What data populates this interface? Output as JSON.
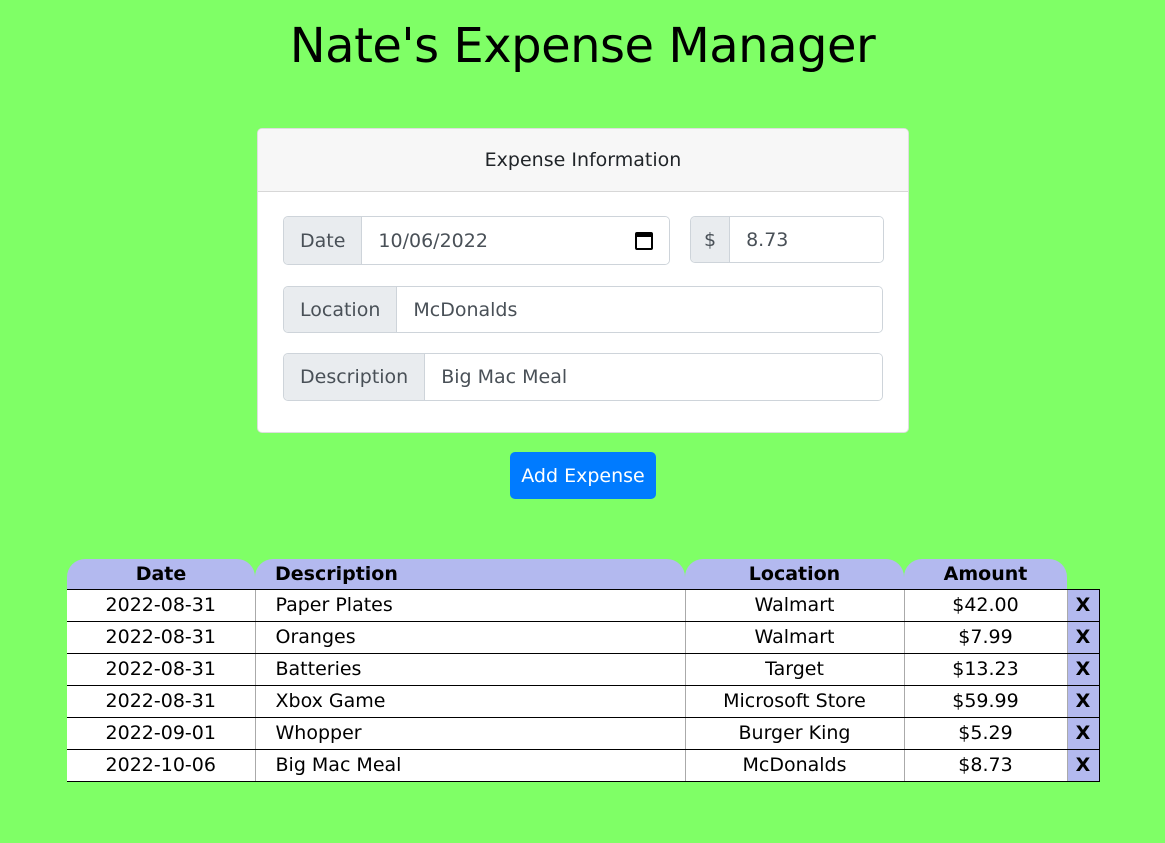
{
  "header": {
    "title": "Nate's Expense Manager"
  },
  "form": {
    "card_title": "Expense Information",
    "date_label": "Date",
    "date_value": "10/06/2022",
    "amount_prefix": "$",
    "amount_value": "8.73",
    "location_label": "Location",
    "location_value": "McDonalds",
    "description_label": "Description",
    "description_value": "Big Mac Meal",
    "add_button": "Add Expense"
  },
  "table": {
    "headers": {
      "date": "Date",
      "description": "Description",
      "location": "Location",
      "amount": "Amount"
    },
    "delete_label": "X",
    "rows": [
      {
        "date": "2022-08-31",
        "description": "Paper Plates",
        "location": "Walmart",
        "amount": "$42.00"
      },
      {
        "date": "2022-08-31",
        "description": "Oranges",
        "location": "Walmart",
        "amount": "$7.99"
      },
      {
        "date": "2022-08-31",
        "description": "Batteries",
        "location": "Target",
        "amount": "$13.23"
      },
      {
        "date": "2022-08-31",
        "description": "Xbox Game",
        "location": "Microsoft Store",
        "amount": "$59.99"
      },
      {
        "date": "2022-09-01",
        "description": "Whopper",
        "location": "Burger King",
        "amount": "$5.29"
      },
      {
        "date": "2022-10-06",
        "description": "Big Mac Meal",
        "location": "McDonalds",
        "amount": "$8.73"
      }
    ]
  },
  "colors": {
    "background": "#7fff66",
    "table_header": "#b3b9ef",
    "button": "#007bff"
  }
}
